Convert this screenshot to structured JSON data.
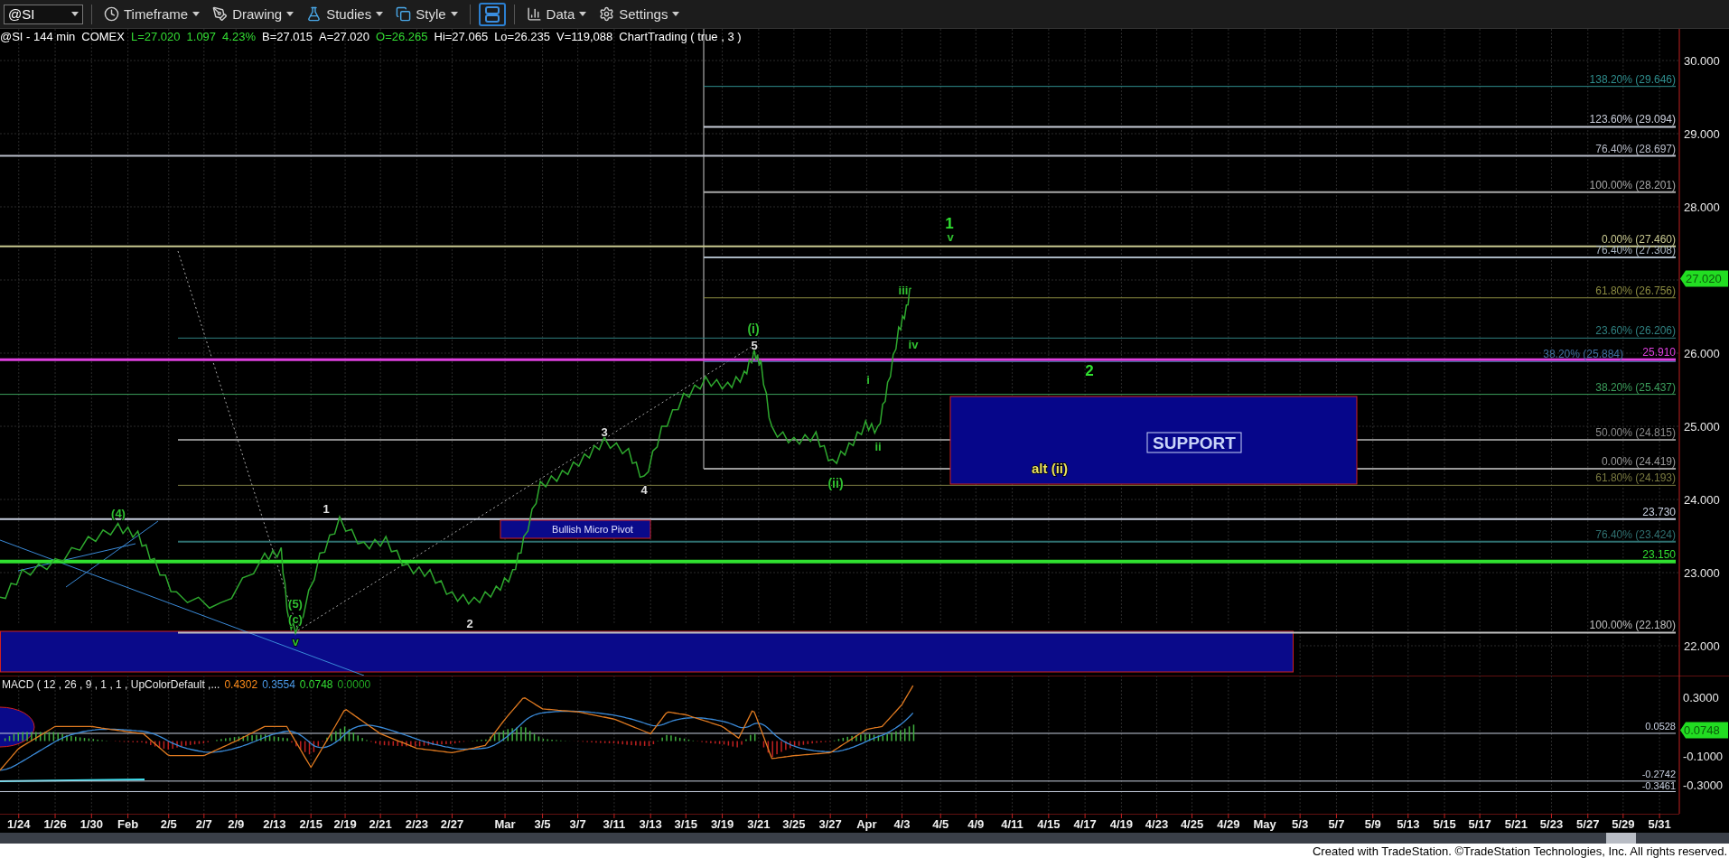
{
  "toolbar": {
    "symbol": "@SI",
    "items": [
      {
        "kind": "clock",
        "label": "Timeframe"
      },
      {
        "kind": "drawing",
        "label": "Drawing"
      },
      {
        "kind": "flask",
        "label": "Studies"
      },
      {
        "kind": "style",
        "label": "Style"
      },
      {
        "kind": "layout",
        "selected": true
      },
      {
        "kind": "data",
        "label": "Data"
      },
      {
        "kind": "gear",
        "label": "Settings"
      }
    ]
  },
  "info_bar": [
    {
      "text": "@SI - 144 min",
      "color": "#ffffff"
    },
    {
      "text": "COMEX",
      "color": "#ffffff"
    },
    {
      "text": "L=27.020",
      "color": "#33dd33"
    },
    {
      "text": "1.097",
      "color": "#33dd33"
    },
    {
      "text": "4.23%",
      "color": "#33dd33"
    },
    {
      "text": "B=27.015",
      "color": "#ffffff"
    },
    {
      "text": "A=27.020",
      "color": "#ffffff"
    },
    {
      "text": "O=26.265",
      "color": "#33dd33"
    },
    {
      "text": "Hi=27.065",
      "color": "#ffffff"
    },
    {
      "text": "Lo=26.235",
      "color": "#ffffff"
    },
    {
      "text": "V=119,088",
      "color": "#ffffff"
    },
    {
      "text": "ChartTrading ( true , 3 )",
      "color": "#ffffff"
    }
  ],
  "price_axis": {
    "ticks": [
      "30.000",
      "29.000",
      "28.000",
      "26.000",
      "25.000",
      "24.000",
      "23.000",
      "22.000"
    ],
    "last_price": "27.020"
  },
  "fib_levels": [
    {
      "label": "138.20% (29.646)",
      "color": "#2f8f8f"
    },
    {
      "label": "123.60% (29.094)",
      "color": "#c8ccd8"
    },
    {
      "label": "76.40% (28.697)",
      "color": "#b8bcc8"
    },
    {
      "label": "100.00% (28.201)",
      "color": "#a8a8a8"
    },
    {
      "label": "0.00% (27.460)",
      "color": "#c8c890"
    },
    {
      "label": "76.40% (27.308)",
      "color": "#a8b4c0"
    },
    {
      "label": "61.80% (26.756)",
      "color": "#8a8a40"
    },
    {
      "label": "23.60% (26.206)",
      "color": "#2f8080"
    },
    {
      "label": "25.910",
      "color": "#e040e0"
    },
    {
      "label": "38.20% (25.884)",
      "color": "#3f70a0"
    },
    {
      "label": "38.20% (25.437)",
      "color": "#3c9f5c"
    },
    {
      "label": "50.00% (24.815)",
      "color": "#8a8a8a"
    },
    {
      "label": "0.00% (24.419)",
      "color": "#9a9a9a"
    },
    {
      "label": "61.80% (24.193)",
      "color": "#7a7a40"
    },
    {
      "label": "23.730",
      "color": "#c8d0e0"
    },
    {
      "label": "76.40% (23.424)",
      "color": "#2f7070"
    },
    {
      "label": "23.150",
      "color": "#30e030"
    },
    {
      "label": "100.00% (22.180)",
      "color": "#c0c0c0"
    }
  ],
  "wave_labels": [
    {
      "text": "(4)",
      "color": "#30c030"
    },
    {
      "text": "1",
      "color": "#e0e0e0"
    },
    {
      "text": "(5)",
      "color": "#30c030"
    },
    {
      "text": "(c)",
      "color": "#30c030"
    },
    {
      "text": "v",
      "color": "#30c030"
    },
    {
      "text": "2",
      "color": "#e0e0e0"
    },
    {
      "text": "3",
      "color": "#e0e0e0"
    },
    {
      "text": "4",
      "color": "#e0e0e0"
    },
    {
      "text": "5",
      "color": "#e0e0e0"
    },
    {
      "text": "(i)",
      "color": "#30c030"
    },
    {
      "text": "(ii)",
      "color": "#30c030"
    },
    {
      "text": "i",
      "color": "#30c030"
    },
    {
      "text": "ii",
      "color": "#30c030"
    },
    {
      "text": "iii",
      "color": "#30c030"
    },
    {
      "text": "iv",
      "color": "#30c030"
    },
    {
      "text": "1",
      "color": "#30e030"
    },
    {
      "text": "v",
      "color": "#30c030"
    },
    {
      "text": "2",
      "color": "#30e030"
    },
    {
      "text": "alt (ii)",
      "color": "#e8e060"
    }
  ],
  "zones": {
    "support": "SUPPORT",
    "pivot": "Bullish Micro Pivot"
  },
  "macd": {
    "title": "MACD ( 12 , 26 , 9 , 1 , 1 , UpColorDefault ,...",
    "values": [
      {
        "text": "0.4302",
        "color": "#ff8c1a"
      },
      {
        "text": "0.3554",
        "color": "#4a9ae8"
      },
      {
        "text": "0.0748",
        "color": "#33dd33"
      },
      {
        "text": "0.0000",
        "color": "#22aa22"
      }
    ],
    "axis_ticks": [
      "0.3000",
      "-0.1000",
      "-0.3000"
    ],
    "levels": [
      "0.0528",
      "-0.2742",
      "-0.3461"
    ],
    "last_value": "0.0748"
  },
  "dates": [
    "1/24",
    "1/26",
    "1/30",
    "Feb",
    "2/5",
    "2/7",
    "2/9",
    "2/13",
    "2/15",
    "2/19",
    "2/21",
    "2/23",
    "2/27",
    "Mar",
    "3/5",
    "3/7",
    "3/11",
    "3/13",
    "3/15",
    "3/19",
    "3/21",
    "3/25",
    "3/27",
    "Apr",
    "4/3",
    "4/5",
    "4/9",
    "4/11",
    "4/15",
    "4/17",
    "4/19",
    "4/23",
    "4/25",
    "4/29",
    "May",
    "5/3",
    "5/7",
    "5/9",
    "5/13",
    "5/15",
    "5/17",
    "5/21",
    "5/23",
    "5/27",
    "5/29",
    "5/31"
  ],
  "footer": "Created with TradeStation. ©TradeStation Technologies, Inc. All rights reserved."
}
